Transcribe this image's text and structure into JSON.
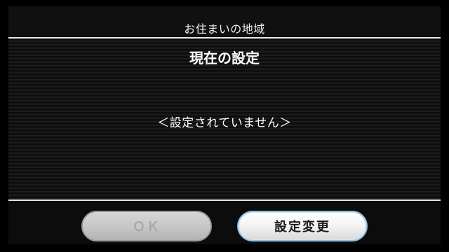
{
  "header": {
    "title": "お住まいの地域"
  },
  "main": {
    "heading": "現在の設定",
    "status": "＜設定されていません＞"
  },
  "footer": {
    "ok_label": "ＯＫ",
    "change_label": "設定変更"
  },
  "colors": {
    "background": "#000000",
    "panel": "#151515",
    "rule": "#e8e8e8",
    "text": "#ffffff",
    "disabled_text": "#a8a8a8",
    "active_border": "#8fbfe0"
  }
}
